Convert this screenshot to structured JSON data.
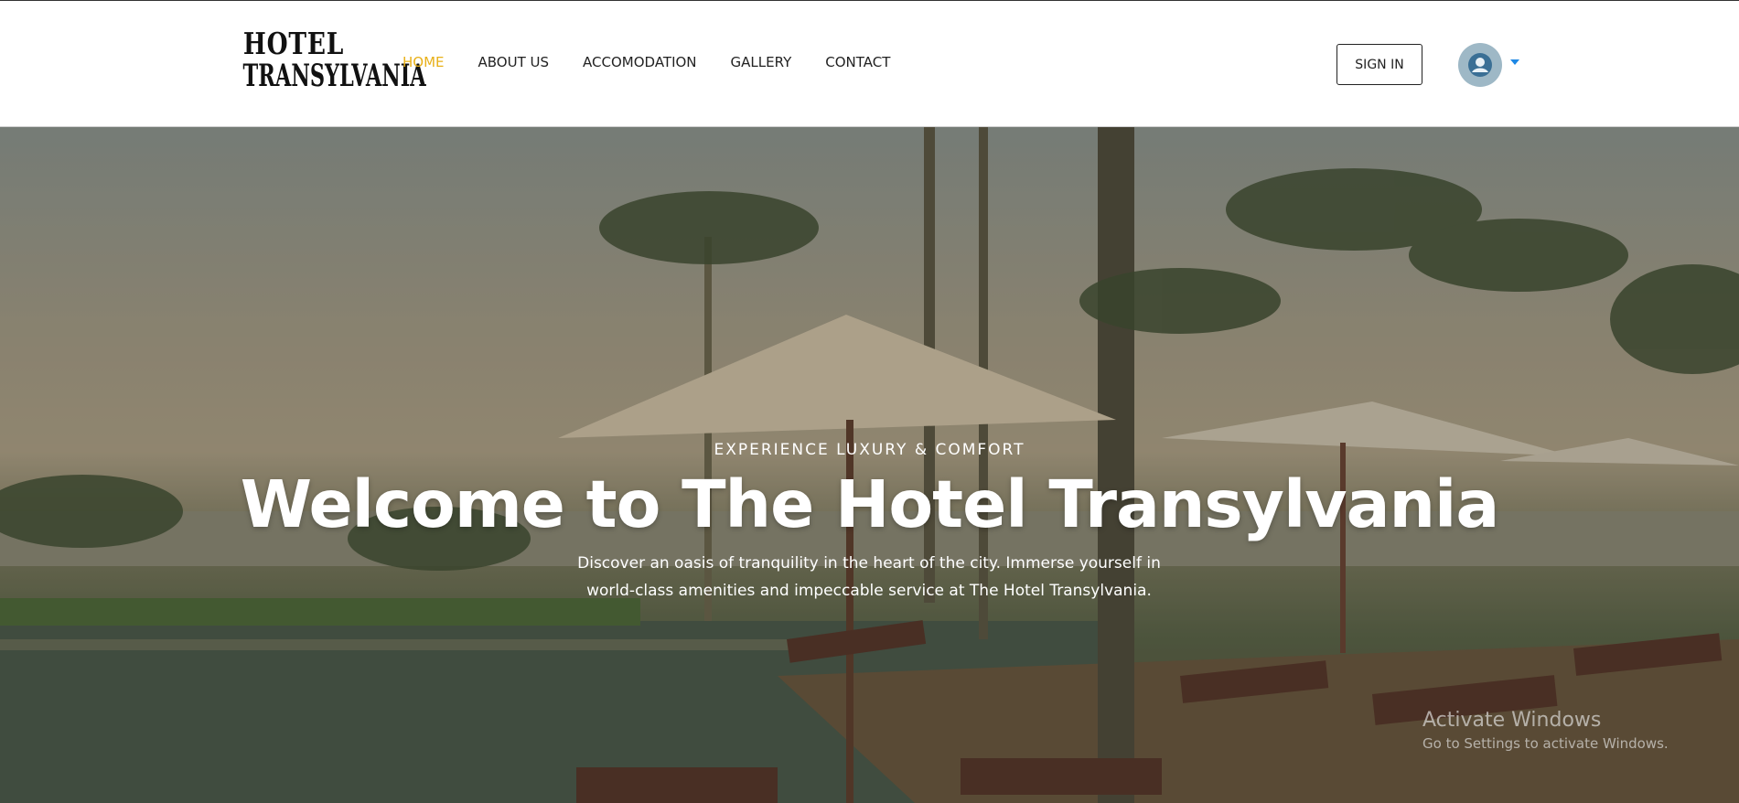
{
  "brand": {
    "logo_line1": "HOTEL",
    "logo_line2": "TRANSYLVANIA"
  },
  "nav": {
    "items": [
      {
        "label": "HOME",
        "active": true
      },
      {
        "label": "ABOUT US",
        "active": false
      },
      {
        "label": "ACCOMODATION",
        "active": false
      },
      {
        "label": "GALLERY",
        "active": false
      },
      {
        "label": "CONTACT",
        "active": false
      }
    ],
    "active_color": "#e8b019"
  },
  "header": {
    "signin_label": "SIGN IN",
    "avatar_icon": "user-avatar-icon",
    "dropdown_icon": "caret-down-icon"
  },
  "hero": {
    "eyebrow": "EXPERIENCE LUXURY & COMFORT",
    "title": "Welcome to The Hotel Transylvania",
    "subtitle": "Discover an oasis of tranquility in the heart of the city. Immerse yourself in world-class amenities and impeccable service at The Hotel Transylvania."
  },
  "watermark": {
    "line1": "Activate Windows",
    "line2": "Go to Settings to activate Windows."
  }
}
